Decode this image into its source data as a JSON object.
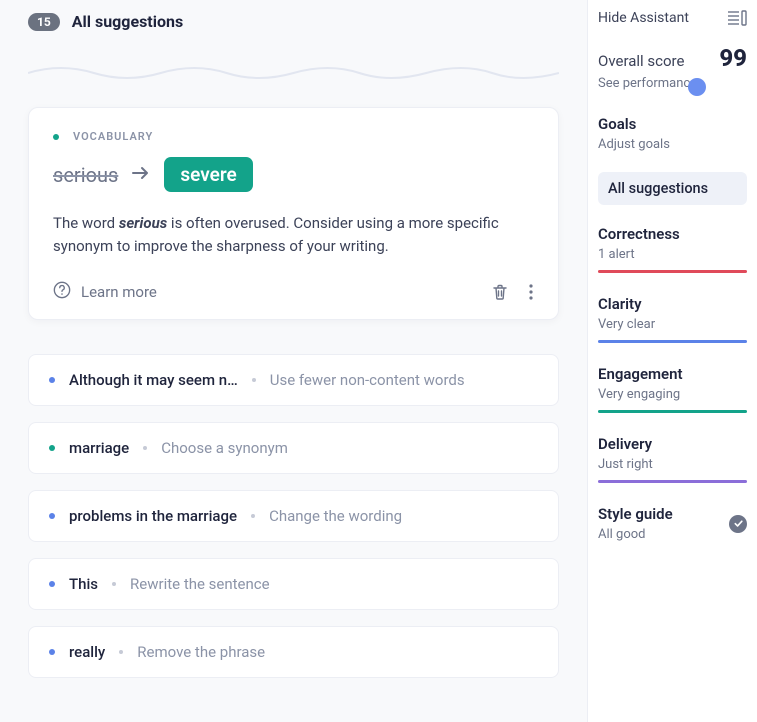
{
  "header": {
    "count": "15",
    "title": "All suggestions"
  },
  "expanded": {
    "category": "VOCABULARY",
    "from": "serious",
    "to": "severe",
    "explain_pre": "The word ",
    "explain_bold": "serious",
    "explain_post": " is often overused. Consider using a more specific synonym to improve the sharpness of your writing.",
    "learn": "Learn more"
  },
  "rows": [
    {
      "dot": "blue",
      "text": "Although it may seem n…",
      "hint": "Use fewer non-content words"
    },
    {
      "dot": "teal",
      "text": "marriage",
      "hint": "Choose a synonym"
    },
    {
      "dot": "blue",
      "text": "problems in the marriage",
      "hint": "Change the wording"
    },
    {
      "dot": "blue",
      "text": "This",
      "hint": "Rewrite the sentence"
    },
    {
      "dot": "blue",
      "text": "really",
      "hint": "Remove the phrase"
    }
  ],
  "sidebar": {
    "hide": "Hide Assistant",
    "score_label": "Overall score",
    "score": "99",
    "score_sub": "See performance",
    "goals_title": "Goals",
    "goals_sub": "Adjust goals",
    "tab": "All suggestions",
    "metrics": [
      {
        "title": "Correctness",
        "sub": "1 alert",
        "color": "red"
      },
      {
        "title": "Clarity",
        "sub": "Very clear",
        "color": "blue"
      },
      {
        "title": "Engagement",
        "sub": "Very engaging",
        "color": "green"
      },
      {
        "title": "Delivery",
        "sub": "Just right",
        "color": "purple"
      }
    ],
    "style_title": "Style guide",
    "style_sub": "All good"
  }
}
